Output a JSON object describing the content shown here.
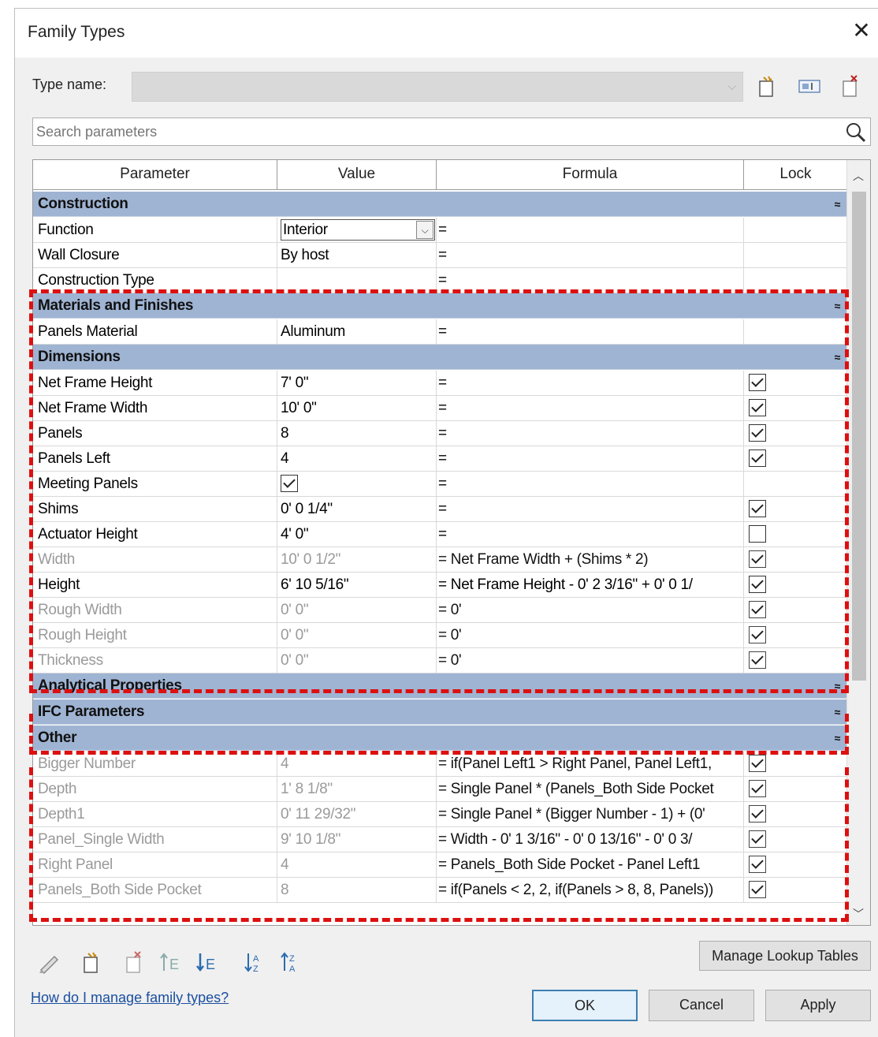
{
  "window": {
    "title": "Family Types",
    "close_glyph": "✕"
  },
  "type_name": {
    "label": "Type name:",
    "value": ""
  },
  "search": {
    "placeholder": "Search parameters"
  },
  "columns": {
    "parameter": "Parameter",
    "value": "Value",
    "formula": "Formula",
    "lock": "Lock"
  },
  "groups": {
    "construction": {
      "label": "Construction",
      "toggle": "≈"
    },
    "materials": {
      "label": "Materials and Finishes",
      "toggle": "≈"
    },
    "dimensions": {
      "label": "Dimensions",
      "toggle": "≈"
    },
    "analytical": {
      "label": "Analytical Properties",
      "toggle": "≈"
    },
    "ifc": {
      "label": "IFC Parameters",
      "toggle": "≈"
    },
    "other": {
      "label": "Other",
      "toggle": "≈"
    }
  },
  "rows": {
    "function": {
      "p": "Function",
      "v": "Interior",
      "f": "="
    },
    "wall_closure": {
      "p": "Wall Closure",
      "v": "By host",
      "f": "="
    },
    "construction_type": {
      "p": "Construction Type",
      "v": "",
      "f": "="
    },
    "panels_material": {
      "p": "Panels Material",
      "v": "Aluminum",
      "f": "="
    },
    "net_frame_height": {
      "p": "Net Frame Height",
      "v": "7'  0\"",
      "f": "=",
      "lock": true
    },
    "net_frame_width": {
      "p": "Net Frame Width",
      "v": "10'  0\"",
      "f": "=",
      "lock": true
    },
    "panels": {
      "p": "Panels",
      "v": "8",
      "f": "=",
      "lock": true
    },
    "panels_left": {
      "p": "Panels Left",
      "v": "4",
      "f": "=",
      "lock": true
    },
    "meeting_panels": {
      "p": "Meeting Panels",
      "checked": true,
      "f": "="
    },
    "shims": {
      "p": "Shims",
      "v": "0'  0 1/4\"",
      "f": "=",
      "lock": true
    },
    "actuator_height": {
      "p": "Actuator Height",
      "v": "4'  0\"",
      "f": "=",
      "lock": false
    },
    "width": {
      "p": "Width",
      "v": "10'  0 1/2\"",
      "f": "= Net Frame Width + (Shims * 2)",
      "lock": true
    },
    "height": {
      "p": "Height",
      "v": "6'  10 5/16\"",
      "f": "= Net Frame Height - 0'  2 3/16\" + 0'  0 1/",
      "lock": true
    },
    "rough_width": {
      "p": "Rough Width",
      "v": "0'  0\"",
      "f": "= 0'",
      "lock": true
    },
    "rough_height": {
      "p": "Rough Height",
      "v": "0'  0\"",
      "f": "= 0'",
      "lock": true
    },
    "thickness": {
      "p": "Thickness",
      "v": "0'  0\"",
      "f": "= 0'",
      "lock": true
    },
    "bigger_number": {
      "p": "Bigger Number",
      "v": "4",
      "f": "= if(Panel Left1 > Right Panel, Panel Left1,",
      "lock": true
    },
    "depth": {
      "p": "Depth",
      "v": "1'  8 1/8\"",
      "f": "= Single Panel * (Panels_Both Side Pocket",
      "lock": true
    },
    "depth1": {
      "p": "Depth1",
      "v": "0'  11 29/32\"",
      "f": "= Single Panel * (Bigger Number - 1) + (0'",
      "lock": true
    },
    "panel_single_width": {
      "p": "Panel_Single Width",
      "v": "9'  10 1/8\"",
      "f": "= Width - 0'  1 3/16\" - 0'  0 13/16\" - 0'  0 3/",
      "lock": true
    },
    "right_panel": {
      "p": "Right Panel",
      "v": "4",
      "f": "= Panels_Both Side Pocket - Panel Left1",
      "lock": true
    },
    "panels_both_side_pocket": {
      "p": "Panels_Both Side Pocket",
      "v": "8",
      "f": "= if(Panels < 2, 2, if(Panels > 8, 8, Panels))",
      "lock": true
    }
  },
  "buttons": {
    "manage_lookup": "Manage Lookup Tables",
    "ok": "OK",
    "cancel": "Cancel",
    "apply": "Apply"
  },
  "help_link": "How do I manage family types?",
  "colors": {
    "group_header": "#9fb4d3",
    "highlight_dash": "#dd1010",
    "link": "#1a4fa0"
  }
}
